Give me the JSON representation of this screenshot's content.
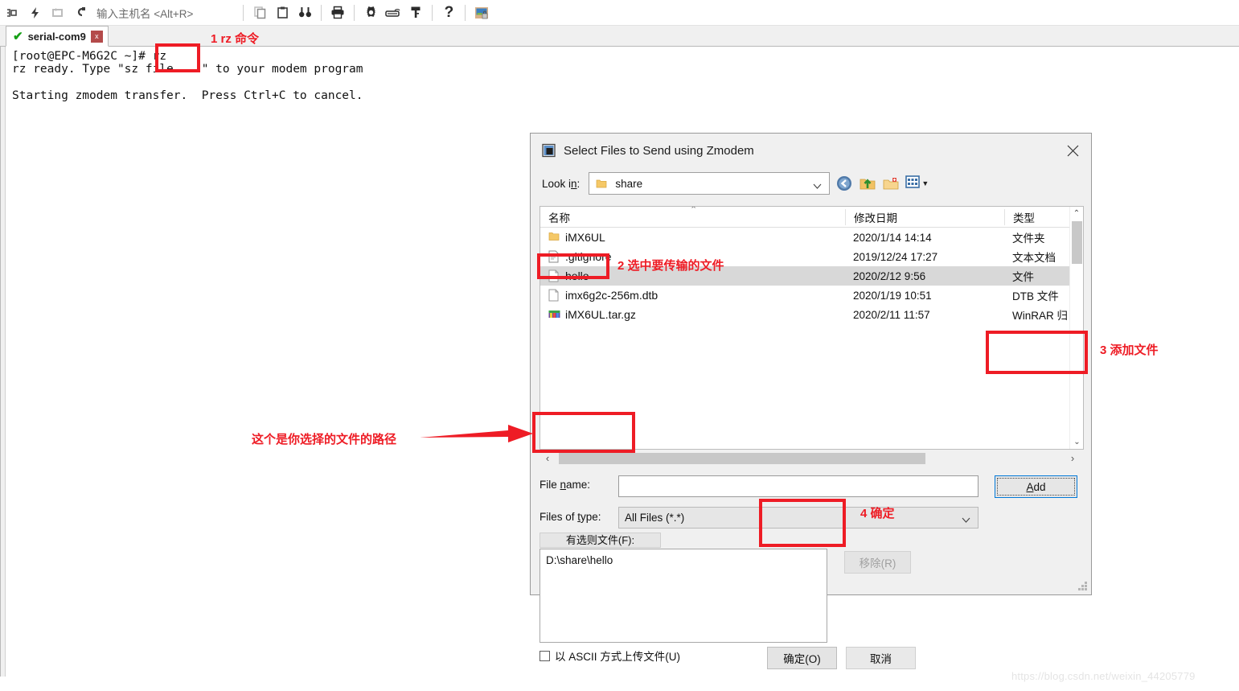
{
  "toolbar": {
    "host_placeholder": "输入主机名 <Alt+R>",
    "icons": [
      {
        "name": "connect-icon",
        "label": "connect"
      },
      {
        "name": "quick-connect-icon",
        "label": "quick connect"
      },
      {
        "name": "reconnect-icon",
        "label": "reconnect"
      },
      {
        "name": "disconnect-icon",
        "label": "disconnect"
      },
      {
        "name": "copy-icon",
        "label": "copy"
      },
      {
        "name": "paste-icon",
        "label": "paste"
      },
      {
        "name": "find-icon",
        "label": "find"
      },
      {
        "name": "print-icon",
        "label": "print"
      },
      {
        "name": "settings-icon",
        "label": "settings"
      },
      {
        "name": "keyboard-icon",
        "label": "keyboard"
      },
      {
        "name": "key-icon",
        "label": "key"
      },
      {
        "name": "help-icon",
        "label": "help"
      },
      {
        "name": "session-options-icon",
        "label": "session options"
      }
    ]
  },
  "tab": {
    "title": "serial-com9",
    "close_label": "x",
    "status_icon": "check-icon"
  },
  "terminal": {
    "lines": [
      "[root@EPC-M6G2C ~]# rz",
      "rz ready. Type \"sz file ...\" to your modem program",
      "",
      "Starting zmodem transfer.  Press Ctrl+C to cancel."
    ]
  },
  "dialog": {
    "title": "Select Files to Send using Zmodem",
    "close_label": "✕",
    "lookin": {
      "label": "Look in:",
      "value": "share",
      "dropdown_arrow": "⌄"
    },
    "nav_icons": [
      {
        "name": "back-icon",
        "label": "Back"
      },
      {
        "name": "up-folder-icon",
        "label": "Up one level"
      },
      {
        "name": "new-folder-icon",
        "label": "Create New Folder"
      },
      {
        "name": "views-icon",
        "label": "Views"
      }
    ],
    "filelist": {
      "columns": [
        "名称",
        "修改日期",
        "类型"
      ],
      "sort_caret": "⌃",
      "rows": [
        {
          "name": "iMX6UL",
          "date": "2020/1/14 14:14",
          "type": "文件夹",
          "icon": "folder-icon",
          "selected": false
        },
        {
          "name": ".gitignore",
          "date": "2019/12/24 17:27",
          "type": "文本文档",
          "icon": "text-file-icon",
          "selected": false
        },
        {
          "name": "hello",
          "date": "2020/2/12 9:56",
          "type": "文件",
          "icon": "file-icon",
          "selected": true
        },
        {
          "name": "imx6g2c-256m.dtb",
          "date": "2020/1/19 10:51",
          "type": "DTB 文件",
          "icon": "file-icon",
          "selected": false
        },
        {
          "name": "iMX6UL.tar.gz",
          "date": "2020/2/11 11:57",
          "type": "WinRAR 归",
          "icon": "archive-icon",
          "selected": false
        }
      ],
      "scroll_up": "⌃",
      "scroll_down": "⌄",
      "scroll_left": "‹",
      "scroll_right": "›"
    },
    "filename": {
      "label_pre": "File ",
      "label_key": "n",
      "label_post": "ame:",
      "value": "",
      "placeholder": ""
    },
    "add_button": {
      "pre": "",
      "key": "A",
      "post": "dd"
    },
    "filetype": {
      "label_pre": "Files of ",
      "label_key": "t",
      "label_post": "ype:",
      "value": "All Files (*.*)",
      "dropdown_arrow": "⌄"
    },
    "selected_group_label": "有选则文件(F):",
    "selected_files": [
      "D:\\share\\hello"
    ],
    "remove_button": "移除(R)",
    "ascii_checkbox": {
      "label": "以 ASCII 方式上传文件(U)",
      "checked": false
    },
    "ok_button": "确定(O)",
    "cancel_button": "取消"
  },
  "annotations": [
    {
      "id": "a1",
      "text": "1 rz 命令"
    },
    {
      "id": "a2",
      "text": "2 选中要传输的文件"
    },
    {
      "id": "a3",
      "text": "3 添加文件"
    },
    {
      "id": "a4",
      "text": "4 确定"
    },
    {
      "id": "a5",
      "text": "这个是你选择的文件的路径"
    }
  ],
  "watermark": "https://blog.csdn.net/weixin_44205779",
  "colors": {
    "annotation_red": "#ee1c25",
    "tab_check_green": "#16a016",
    "focus_blue": "#0078d7",
    "selection_gray": "#d8d8d8"
  }
}
